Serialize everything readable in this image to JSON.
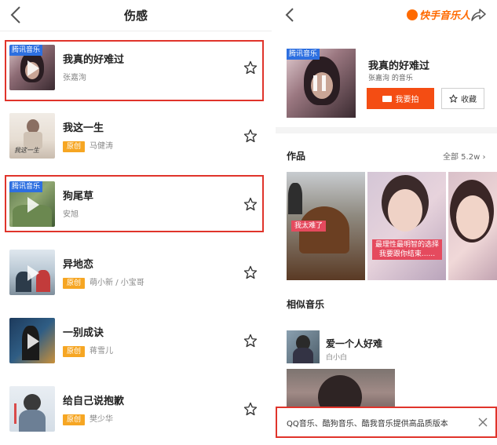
{
  "left": {
    "title": "伤感",
    "songs": [
      {
        "name": "我真的好难过",
        "artist": "张嘉洵",
        "tag": "腾讯音乐",
        "original": null
      },
      {
        "name": "我这一生",
        "artist": "马健涛",
        "tag": null,
        "original": "原创",
        "cover_text": "我这一生"
      },
      {
        "name": "狗尾草",
        "artist": "安旭",
        "tag": "腾讯音乐",
        "original": null
      },
      {
        "name": "异地恋",
        "artist": "萌小新 / 小宝哥",
        "tag": null,
        "original": "原创"
      },
      {
        "name": "一别成诀",
        "artist": "蒋雪儿",
        "tag": null,
        "original": "原创"
      },
      {
        "name": "给自己说抱歉",
        "artist": "樊少华",
        "tag": null,
        "original": "原创"
      }
    ]
  },
  "right": {
    "logo_text": "快手音乐人",
    "album_tag": "腾讯音乐",
    "song_title": "我真的好难过",
    "song_artist": "张嘉洵  的音乐",
    "shoot_label": "我要拍",
    "fav_label": "收藏",
    "works_title": "作品",
    "works_all": "全部 5.2w",
    "works": [
      {
        "caption": "我太难了"
      },
      {
        "caption": "最理性最明智的选择\n我要跟你结束......"
      },
      {
        "caption": ""
      }
    ],
    "similar_title": "相似音乐",
    "similar": {
      "name": "爱一个人好难",
      "artist": "白小白"
    },
    "banner_text": "QQ音乐、酷狗音乐、酷我音乐提供高品质版本"
  },
  "colors": {
    "accent_orange": "#f44d13",
    "badge_orange": "#f6a623",
    "tag_blue": "#2d6fe0",
    "highlight_red": "#e0342b"
  }
}
